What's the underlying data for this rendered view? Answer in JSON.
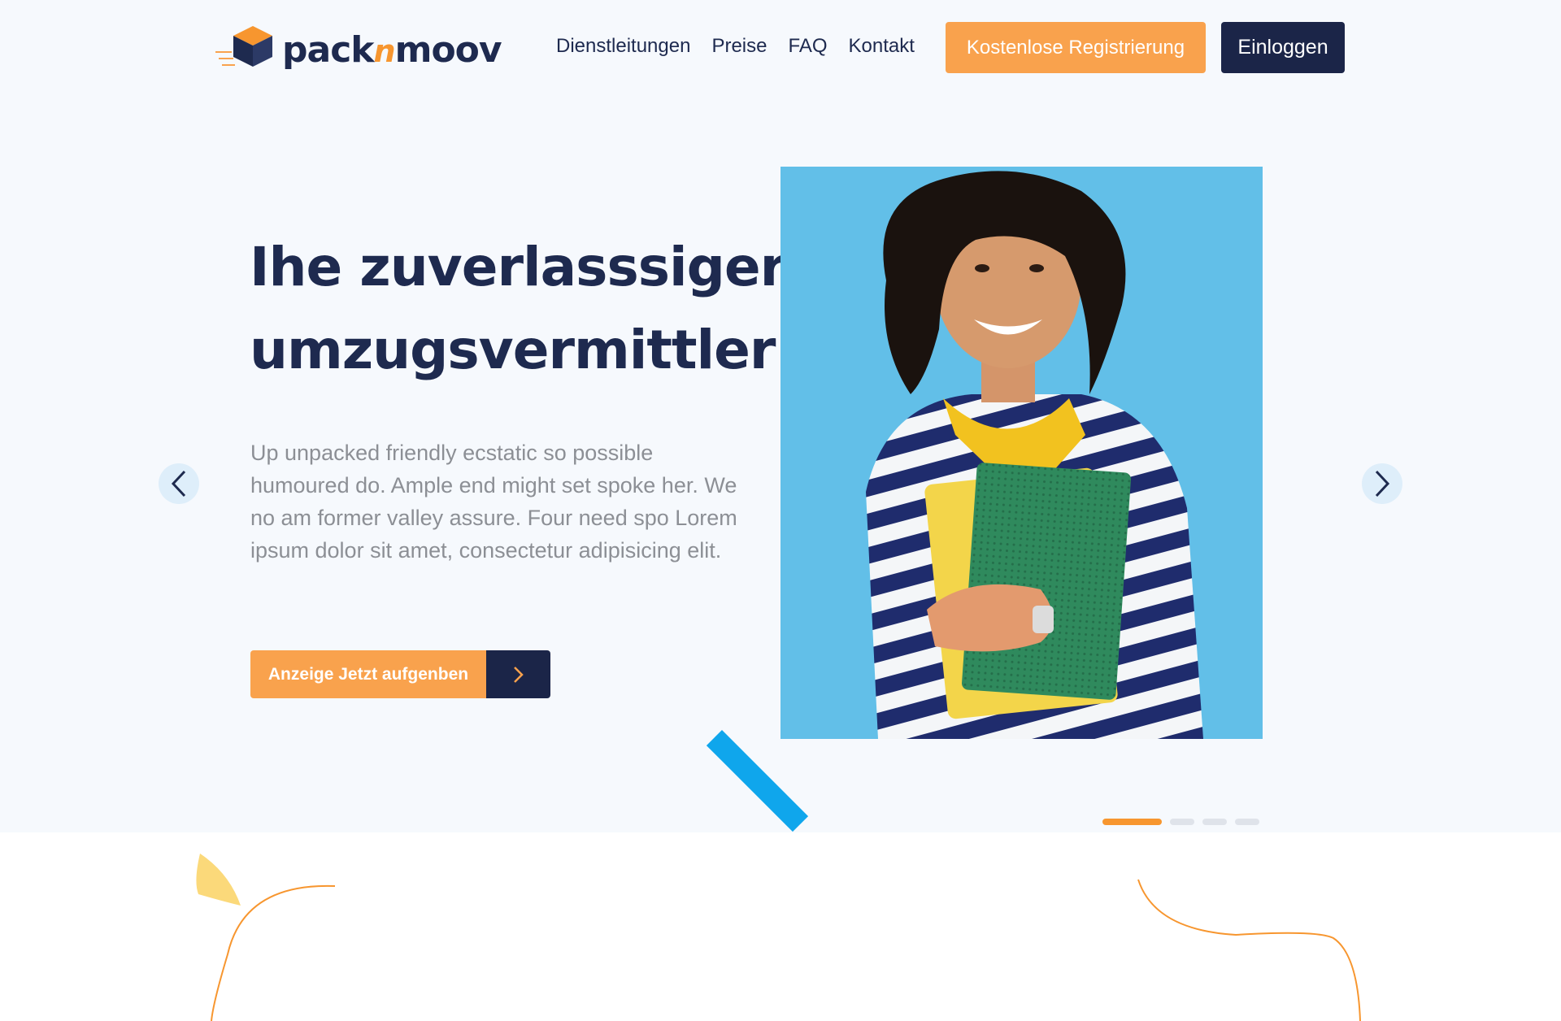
{
  "header": {
    "logo": {
      "text_left": "pack",
      "text_mid": "n",
      "text_right": "moov"
    },
    "nav": [
      {
        "label": "Dienstleitungen"
      },
      {
        "label": "Preise"
      },
      {
        "label": "FAQ"
      },
      {
        "label": "Kontakt"
      }
    ],
    "register_label": "Kostenlose Registrierung",
    "login_label": "Einloggen"
  },
  "hero": {
    "title_line1": "Ihe zuverlasssiger",
    "title_line2": "umzugsvermittler",
    "text": "Up unpacked friendly ecstatic so possible humoured do. Ample end might set spoke her. We no am former valley assure. Four need spo Lorem ipsum dolor sit amet, consectetur adipisicing elit.",
    "cta_label": "Anzeige Jetzt aufgenben",
    "slider": {
      "active_slide": 1,
      "total_slides": 4
    }
  },
  "icons": {
    "prev": "chevron-left-icon",
    "next": "chevron-right-icon",
    "cta": "chevron-right-icon"
  },
  "colors": {
    "navy": "#1b2548",
    "orange": "#f9a24d",
    "hero_background": "#f6f9fd",
    "photo_background": "#62bfe8",
    "accent_blue": "#0fa6ec"
  }
}
